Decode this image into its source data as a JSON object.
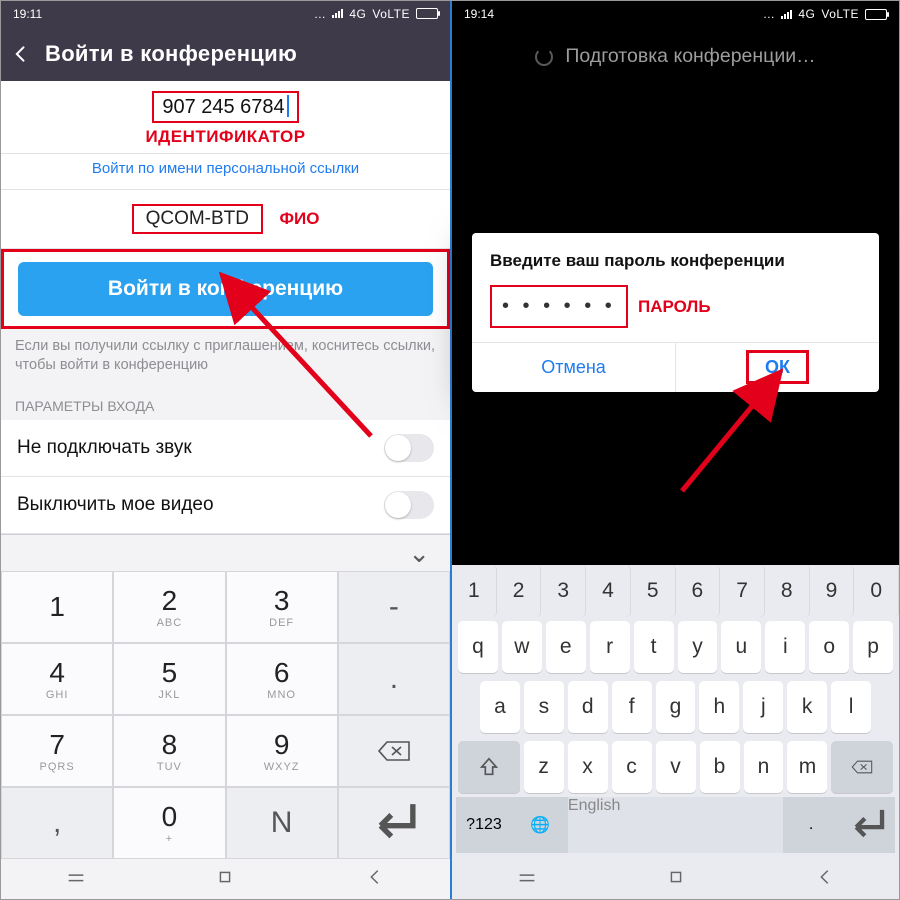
{
  "left": {
    "status_time": "19:11",
    "status_net": "4G",
    "status_volte": "VoLTE",
    "title": "Войти в конференцию",
    "id_value": "907 245 6784",
    "anno_id": "ИДЕНТИФИКАТОР",
    "link": "Войти по имени персональной ссылки",
    "name_value": "QCOM-BTD",
    "anno_fio": "ФИО",
    "join_btn": "Войти в конференцию",
    "hint": "Если вы получили ссылку с приглашением, коснитесь ссылки, чтобы войти в конференцию",
    "section": "ПАРАМЕТРЫ ВХОДА",
    "opt_audio": "Не подключать звук",
    "opt_video": "Выключить мое видео",
    "keypad": {
      "r1": [
        "1",
        "2",
        "3"
      ],
      "r2": [
        "4",
        "5",
        "6"
      ],
      "r3": [
        "7",
        "8",
        "9"
      ],
      "r4": [
        "0"
      ],
      "subs": {
        "2": "ABC",
        "3": "DEF",
        "4": "GHI",
        "5": "JKL",
        "6": "MNO",
        "7": "PQRS",
        "8": "TUV",
        "9": "WXYZ",
        "0": "+"
      },
      "side": {
        "dash": "-",
        "dot": ".",
        "comma": ",",
        "n": "N"
      }
    }
  },
  "right": {
    "status_time": "19:14",
    "status_net": "4G",
    "status_volte": "VoLTE",
    "preparing": "Подготовка конференции…",
    "dlg_title": "Введите ваш пароль конференции",
    "pwd_value": "• • • • • •",
    "anno_pwd": "ПАРОЛЬ",
    "cancel": "Отмена",
    "ok": "ОК",
    "kb": {
      "nums": [
        "1",
        "2",
        "3",
        "4",
        "5",
        "6",
        "7",
        "8",
        "9",
        "0"
      ],
      "r1": [
        "q",
        "w",
        "e",
        "r",
        "t",
        "y",
        "u",
        "i",
        "o",
        "p"
      ],
      "r2": [
        "a",
        "s",
        "d",
        "f",
        "g",
        "h",
        "j",
        "k",
        "l"
      ],
      "r3": [
        "z",
        "x",
        "c",
        "v",
        "b",
        "n",
        "m"
      ],
      "sym": "?123",
      "space": "English"
    }
  }
}
